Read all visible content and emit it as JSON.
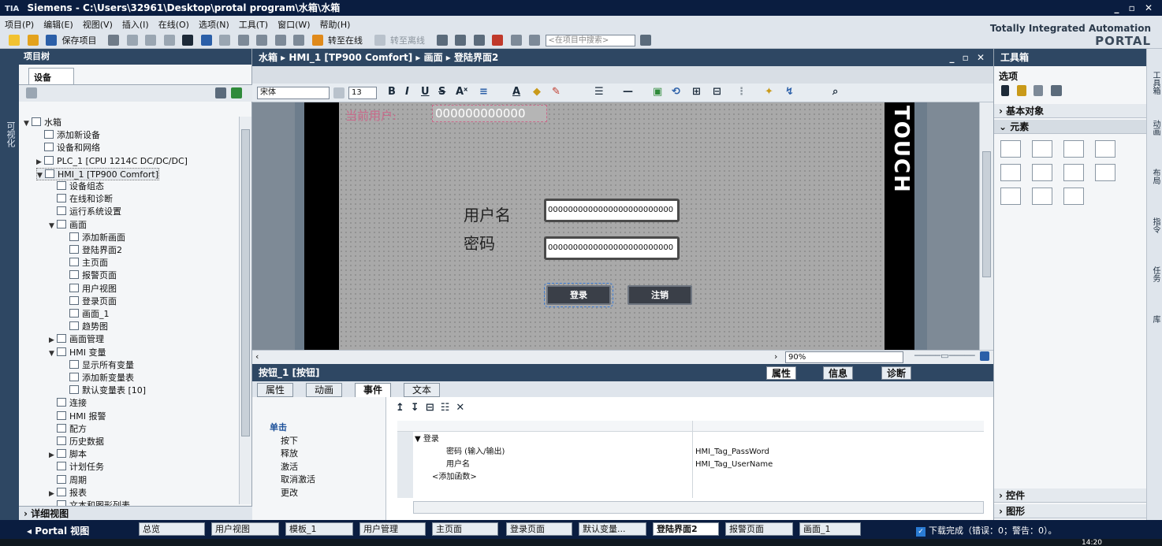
{
  "window": {
    "title": "Siemens  -  C:\\Users\\32961\\Desktop\\protal program\\水箱\\水箱",
    "logo": "TIA",
    "controls": "_ ▫ ✕"
  },
  "menu": [
    "项目(P)",
    "编辑(E)",
    "视图(V)",
    "插入(I)",
    "在线(O)",
    "选项(N)",
    "工具(T)",
    "窗口(W)",
    "帮助(H)"
  ],
  "toolbar": {
    "save_label": "保存项目",
    "go_online": "转至在线",
    "go_offline": "转至离线",
    "search_placeholder": "<在项目中搜索>"
  },
  "branding": {
    "line1": "Totally Integrated Automation",
    "line2": "PORTAL"
  },
  "left_strip": {
    "label": "可视化"
  },
  "project_tree": {
    "title": "项目树",
    "tab": "设备",
    "nodes": [
      {
        "label": "水箱",
        "indent": 0,
        "twisty": "▼"
      },
      {
        "label": "添加新设备",
        "indent": 1,
        "twisty": ""
      },
      {
        "label": "设备和网络",
        "indent": 1,
        "twisty": ""
      },
      {
        "label": "PLC_1 [CPU 1214C DC/DC/DC]",
        "indent": 1,
        "twisty": "▶"
      },
      {
        "label": "HMI_1 [TP900 Comfort]",
        "indent": 1,
        "twisty": "▼"
      },
      {
        "label": "设备组态",
        "indent": 2,
        "twisty": ""
      },
      {
        "label": "在线和诊断",
        "indent": 2,
        "twisty": ""
      },
      {
        "label": "运行系统设置",
        "indent": 2,
        "twisty": ""
      },
      {
        "label": "画面",
        "indent": 2,
        "twisty": "▼"
      },
      {
        "label": "添加新画面",
        "indent": 3,
        "twisty": ""
      },
      {
        "label": "登陆界面2",
        "indent": 3,
        "twisty": ""
      },
      {
        "label": "主页面",
        "indent": 3,
        "twisty": ""
      },
      {
        "label": "报警页面",
        "indent": 3,
        "twisty": ""
      },
      {
        "label": "用户视图",
        "indent": 3,
        "twisty": ""
      },
      {
        "label": "登录页面",
        "indent": 3,
        "twisty": ""
      },
      {
        "label": "画面_1",
        "indent": 3,
        "twisty": ""
      },
      {
        "label": "趋势图",
        "indent": 3,
        "twisty": ""
      },
      {
        "label": "画面管理",
        "indent": 2,
        "twisty": "▶"
      },
      {
        "label": "HMI 变量",
        "indent": 2,
        "twisty": "▼"
      },
      {
        "label": "显示所有变量",
        "indent": 3,
        "twisty": ""
      },
      {
        "label": "添加新变量表",
        "indent": 3,
        "twisty": ""
      },
      {
        "label": "默认变量表 [10]",
        "indent": 3,
        "twisty": ""
      },
      {
        "label": "连接",
        "indent": 2,
        "twisty": ""
      },
      {
        "label": "HMI 报警",
        "indent": 2,
        "twisty": ""
      },
      {
        "label": "配方",
        "indent": 2,
        "twisty": ""
      },
      {
        "label": "历史数据",
        "indent": 2,
        "twisty": ""
      },
      {
        "label": "脚本",
        "indent": 2,
        "twisty": "▶"
      },
      {
        "label": "计划任务",
        "indent": 2,
        "twisty": ""
      },
      {
        "label": "周期",
        "indent": 2,
        "twisty": ""
      },
      {
        "label": "报表",
        "indent": 2,
        "twisty": "▶"
      },
      {
        "label": "文本和图形列表",
        "indent": 2,
        "twisty": ""
      }
    ],
    "detail_view": "详细视图"
  },
  "editor": {
    "breadcrumb": "水箱 ▸ HMI_1 [TP900 Comfort] ▸ 画面 ▸ 登陆界面2",
    "font": "宋体",
    "font_size": "13",
    "zoom": "90%",
    "screen": {
      "current_user_label": "当前用户:",
      "current_user_value": "000000000000",
      "username_label": "用户名",
      "password_label": "密码",
      "username_value": "0000000000000000000000000",
      "password_value": "0000000000000000000000000",
      "login_button": "登录",
      "logout_button": "注销",
      "brand_vertical": "TOUCH"
    }
  },
  "properties": {
    "object": "按钮_1 [按钮]",
    "tabs": [
      "属性",
      "信息",
      "诊断"
    ],
    "subtabs": [
      "属性",
      "动画",
      "事件",
      "文本"
    ],
    "active_subtab": "事件",
    "events": [
      "单击",
      "按下",
      "释放",
      "激活",
      "取消激活",
      "更改"
    ],
    "grid": {
      "function": "登录",
      "rows": [
        {
          "param": "密码 (输入/输出)",
          "value": "HMI_Tag_PassWord"
        },
        {
          "param": "用户名",
          "value": "HMI_Tag_UserName"
        }
      ],
      "add_function": "<添加函数>"
    }
  },
  "toolbox": {
    "title": "工具箱",
    "options": "选项",
    "sections": {
      "basic": "基本对象",
      "elements": "元素",
      "controls": "控件",
      "graphics": "图形"
    },
    "side_tabs": [
      "工具箱",
      "动画",
      "布局",
      "指令",
      "任务",
      "库"
    ]
  },
  "bottom_bar": {
    "portal": "Portal 视图",
    "tasks": [
      "总览",
      "用户视图",
      "模板_1",
      "用户管理",
      "主页面",
      "登录页面",
      "默认变量...",
      "登陆界面2",
      "报警页面",
      "画面_1"
    ],
    "active_task": "登陆界面2",
    "status": "下载完成（错误：0；警告：0）。",
    "clock": "14:20"
  },
  "colors": {
    "header": "#2e4763",
    "titlebar": "#0a1d40",
    "accent": "#1a4f99"
  }
}
